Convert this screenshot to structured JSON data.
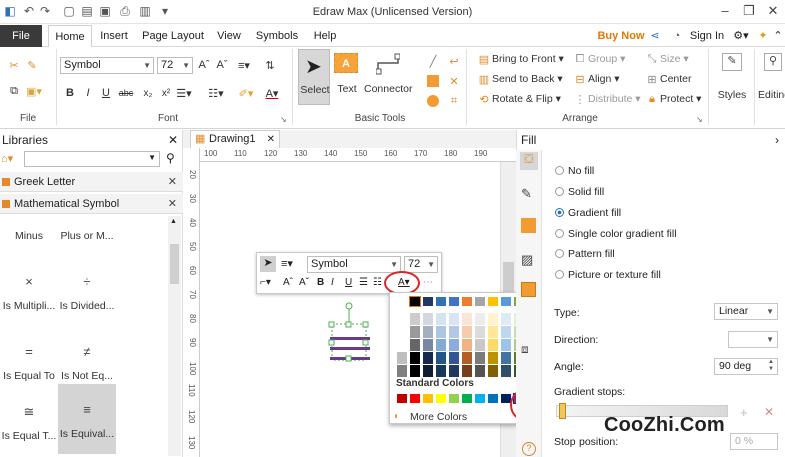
{
  "app": {
    "title": "Edraw Max (Unlicensed Version)",
    "buy_now": "Buy Now",
    "sign_in": "Sign In"
  },
  "menu": {
    "tabs": [
      "File",
      "Home",
      "Insert",
      "Page Layout",
      "View",
      "Symbols",
      "Help"
    ]
  },
  "ribbon": {
    "groups": {
      "file": "File",
      "font": "Font",
      "basic_tools": "Basic Tools",
      "arrange": "Arrange"
    },
    "font_name": "Symbol",
    "font_size": "72",
    "tools": {
      "select": "Select",
      "text": "Text",
      "connector": "Connector"
    },
    "arrange": {
      "bring_to_front": "Bring to Front",
      "send_to_back": "Send to Back",
      "rotate_flip": "Rotate & Flip",
      "group": "Group",
      "align": "Align",
      "distribute": "Distribute",
      "size": "Size",
      "center": "Center",
      "protect": "Protect"
    },
    "styles": "Styles",
    "editing": "Editing"
  },
  "libraries": {
    "title": "Libraries",
    "categories": [
      "Greek Letter",
      "Mathematical Symbol"
    ],
    "shapes": [
      {
        "symbol": "",
        "label": "Minus"
      },
      {
        "symbol": "",
        "label": "Plus or M..."
      },
      {
        "symbol": "×",
        "label": "Is Multipli..."
      },
      {
        "symbol": "÷",
        "label": "Is Divided..."
      },
      {
        "symbol": "=",
        "label": "Is Equal To"
      },
      {
        "symbol": "≠",
        "label": "Is Not Eq..."
      },
      {
        "symbol": "≅",
        "label": "Is Equal T..."
      },
      {
        "symbol": "≡",
        "label": "Is Equival..."
      }
    ]
  },
  "canvas": {
    "doc_tab": "Drawing1",
    "ruler_ticks": [
      "100",
      "110",
      "120",
      "130",
      "140",
      "150",
      "160",
      "170",
      "180",
      "190"
    ],
    "vruler_ticks": [
      "20",
      "30",
      "40",
      "50",
      "60",
      "70",
      "80",
      "90",
      "100",
      "110",
      "120",
      "130"
    ]
  },
  "float_toolbar": {
    "font_name": "Symbol",
    "font_size": "72"
  },
  "color_picker": {
    "standard_colors_label": "Standard Colors",
    "more_colors": "More Colors",
    "theme_top": [
      "#ffffff",
      "#000000",
      "#1f3864",
      "#2e74b5",
      "#4472c4",
      "#ed7d31",
      "#a5a5a5",
      "#ffc000",
      "#5b9bd5",
      "#70ad47"
    ],
    "standard": [
      "#c00000",
      "#ff0000",
      "#ffc000",
      "#ffff00",
      "#92d050",
      "#00b050",
      "#00b0f0",
      "#0070c0",
      "#002060",
      "#7030a0"
    ]
  },
  "fill_panel": {
    "title": "Fill",
    "options": [
      "No fill",
      "Solid fill",
      "Gradient fill",
      "Single color gradient fill",
      "Pattern fill",
      "Picture or texture fill"
    ],
    "selected_index": 2,
    "type_label": "Type:",
    "type_value": "Linear",
    "direction_label": "Direction:",
    "angle_label": "Angle:",
    "angle_value": "90 deg",
    "gradient_stops_label": "Gradient stops:",
    "stop_label": "Stop",
    "position_label": "position:",
    "stop_value": "0 %"
  },
  "watermark": "CooZhi.Com"
}
